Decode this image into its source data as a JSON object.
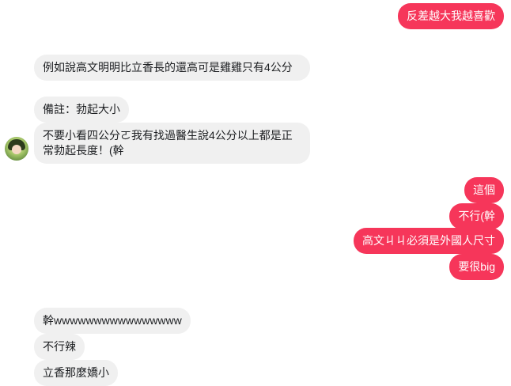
{
  "messages": {
    "out_1": "反差越大我越喜歡",
    "in_1": "例如說高文明明比立香長的還高可是雞雞只有4公分",
    "in_2": "備註：勃起大小",
    "in_3": "不要小看四公分ㄛ我有找過醫生說4公分以上都是正常勃起長度！(幹",
    "out_2": "這個",
    "out_3": "不行(幹",
    "out_4": "高文ㄐㄐ必須是外國人尺寸",
    "out_5": "要很big",
    "in_4": "幹wwwwwwwwwwwwwwww",
    "in_5": "不行辣",
    "in_6": "立香那麼嬌小"
  },
  "colors": {
    "outgoing_bubble": "#f6365a",
    "incoming_bubble": "#f0f0f0"
  },
  "icons": {
    "avatar": "contact-avatar"
  }
}
